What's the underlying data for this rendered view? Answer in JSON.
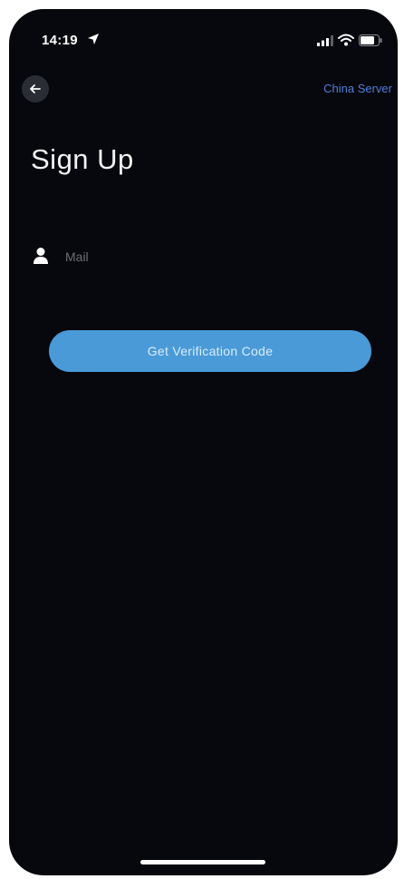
{
  "status_bar": {
    "time": "14:19"
  },
  "icons": {
    "location": "location-arrow-icon",
    "signal": "signal-icon",
    "wifi": "wifi-icon",
    "battery": "battery-icon",
    "back": "back-arrow-icon",
    "person": "person-icon"
  },
  "header": {
    "server_link": "China Server"
  },
  "title": "Sign Up",
  "form": {
    "mail_placeholder": "Mail",
    "mail_value": "",
    "submit_label": "Get Verification Code"
  },
  "colors": {
    "background": "#06080d",
    "accent": "#4a9ad8",
    "link": "#4f7fd6"
  }
}
